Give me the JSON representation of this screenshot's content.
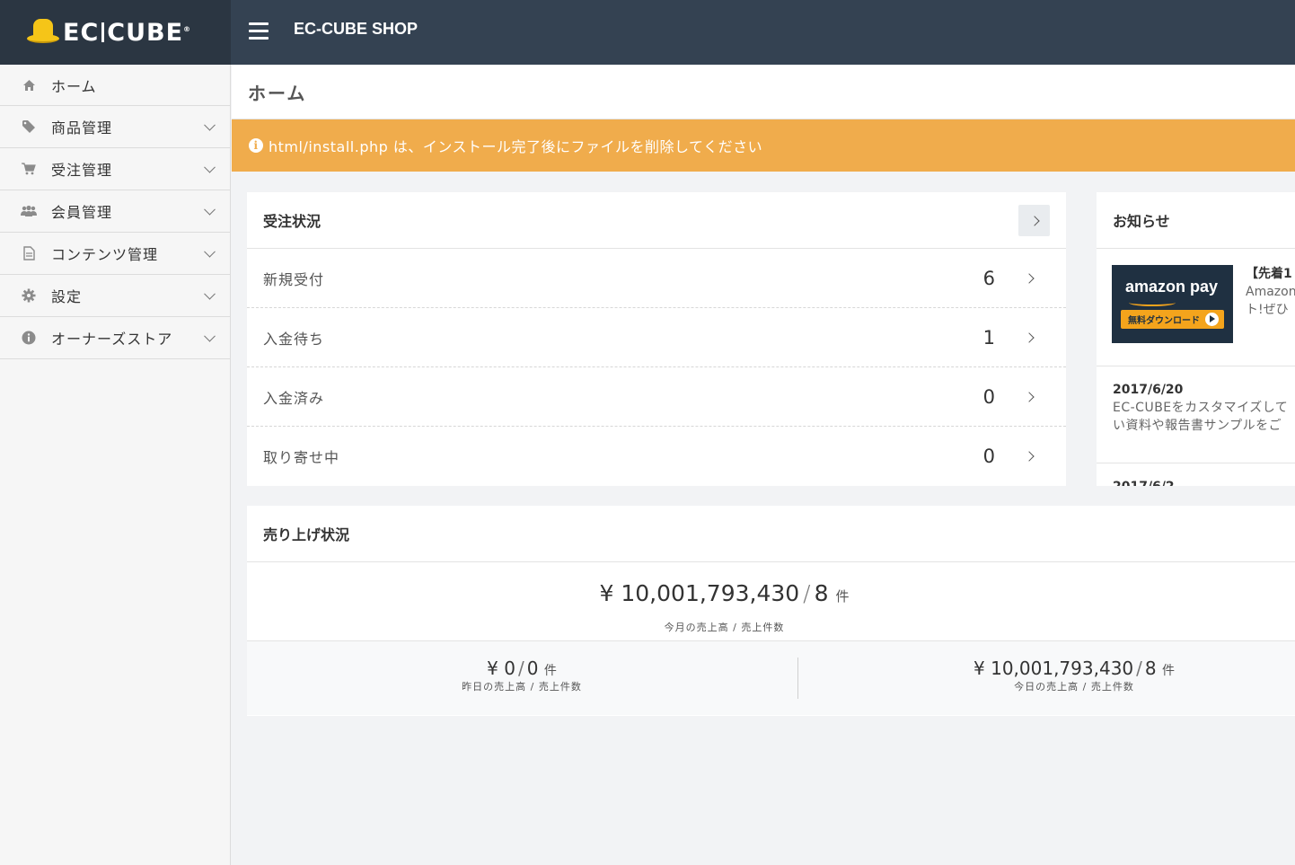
{
  "header": {
    "logo_text": "EC",
    "logo_text2": "CUBE",
    "logo_mark": "®",
    "shop_name": "EC-CUBE SHOP"
  },
  "sidebar": {
    "items": [
      {
        "label": "ホーム",
        "icon": "home-icon",
        "has_children": false
      },
      {
        "label": "商品管理",
        "icon": "tag-icon",
        "has_children": true
      },
      {
        "label": "受注管理",
        "icon": "cart-icon",
        "has_children": true
      },
      {
        "label": "会員管理",
        "icon": "users-icon",
        "has_children": true
      },
      {
        "label": "コンテンツ管理",
        "icon": "file-icon",
        "has_children": true
      },
      {
        "label": "設定",
        "icon": "gear-icon",
        "has_children": true
      },
      {
        "label": "オーナーズストア",
        "icon": "info-icon",
        "has_children": true
      }
    ]
  },
  "page": {
    "title": "ホーム",
    "alert": "html/install.php は、インストール完了後にファイルを削除してください",
    "alert_color": "#f0ac4c"
  },
  "orders": {
    "title": "受注状況",
    "rows": [
      {
        "label": "新規受付",
        "count": "6"
      },
      {
        "label": "入金待ち",
        "count": "1"
      },
      {
        "label": "入金済み",
        "count": "0"
      },
      {
        "label": "取り寄せ中",
        "count": "0"
      }
    ]
  },
  "news": {
    "title": "お知らせ",
    "banner": {
      "logo_text": "amazon pay",
      "button_text": "無料ダウンロード",
      "line1": "【先着1",
      "line2": "Amazon",
      "line3": "ト!ぜひ"
    },
    "items": [
      {
        "date": "2017/6/20",
        "line1": "EC-CUBEをカスタマイズして",
        "line2": "い資料や報告書サンプルをご"
      }
    ],
    "next_date": "2017/6/2"
  },
  "sales": {
    "title": "売り上げ状況",
    "month": {
      "amount": "¥ 10,001,793,430",
      "count": "8",
      "unit": "件",
      "label": "今月の売上高 / 売上件数"
    },
    "yesterday": {
      "amount": "¥ 0",
      "count": "0",
      "unit": "件",
      "label": "昨日の売上高 / 売上件数"
    },
    "today": {
      "amount": "¥ 10,001,793,430",
      "count": "8",
      "unit": "件",
      "label": "今日の売上高 / 売上件数"
    }
  }
}
